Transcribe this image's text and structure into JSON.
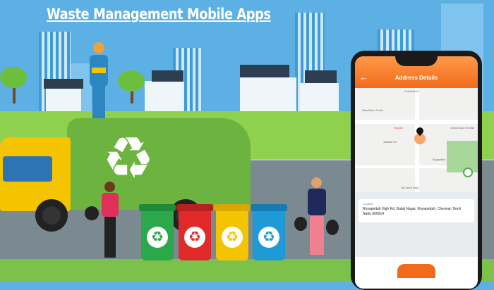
{
  "title": "Waste Management Mobile Apps",
  "colors": {
    "sky": "#5cb0e4",
    "accent": "#f26a1b",
    "truck_green": "#6db33f",
    "truck_yellow": "#f5c400"
  },
  "bins": [
    {
      "color": "#2aa84a",
      "icon": "recycle-icon"
    },
    {
      "color": "#e02a2a",
      "icon": "recycle-icon"
    },
    {
      "color": "#f5c400",
      "icon": "recycle-icon"
    },
    {
      "color": "#1e9ad6",
      "icon": "recycle-icon"
    }
  ],
  "phone": {
    "back_icon": "←",
    "screen_title": "Address Details",
    "map_labels": [
      "Federal Bank",
      "State Bank of India",
      "Hospital",
      "Central Bank Of India",
      "Jawahar Rd",
      "City Union Bank",
      "Royapettah"
    ],
    "location_label": "Location",
    "location_value": "Royapettah High Rd, Balaji Nagar, Royapettah, Chennai, Tamil Nadu 600014"
  },
  "recycle_glyph": "♻"
}
